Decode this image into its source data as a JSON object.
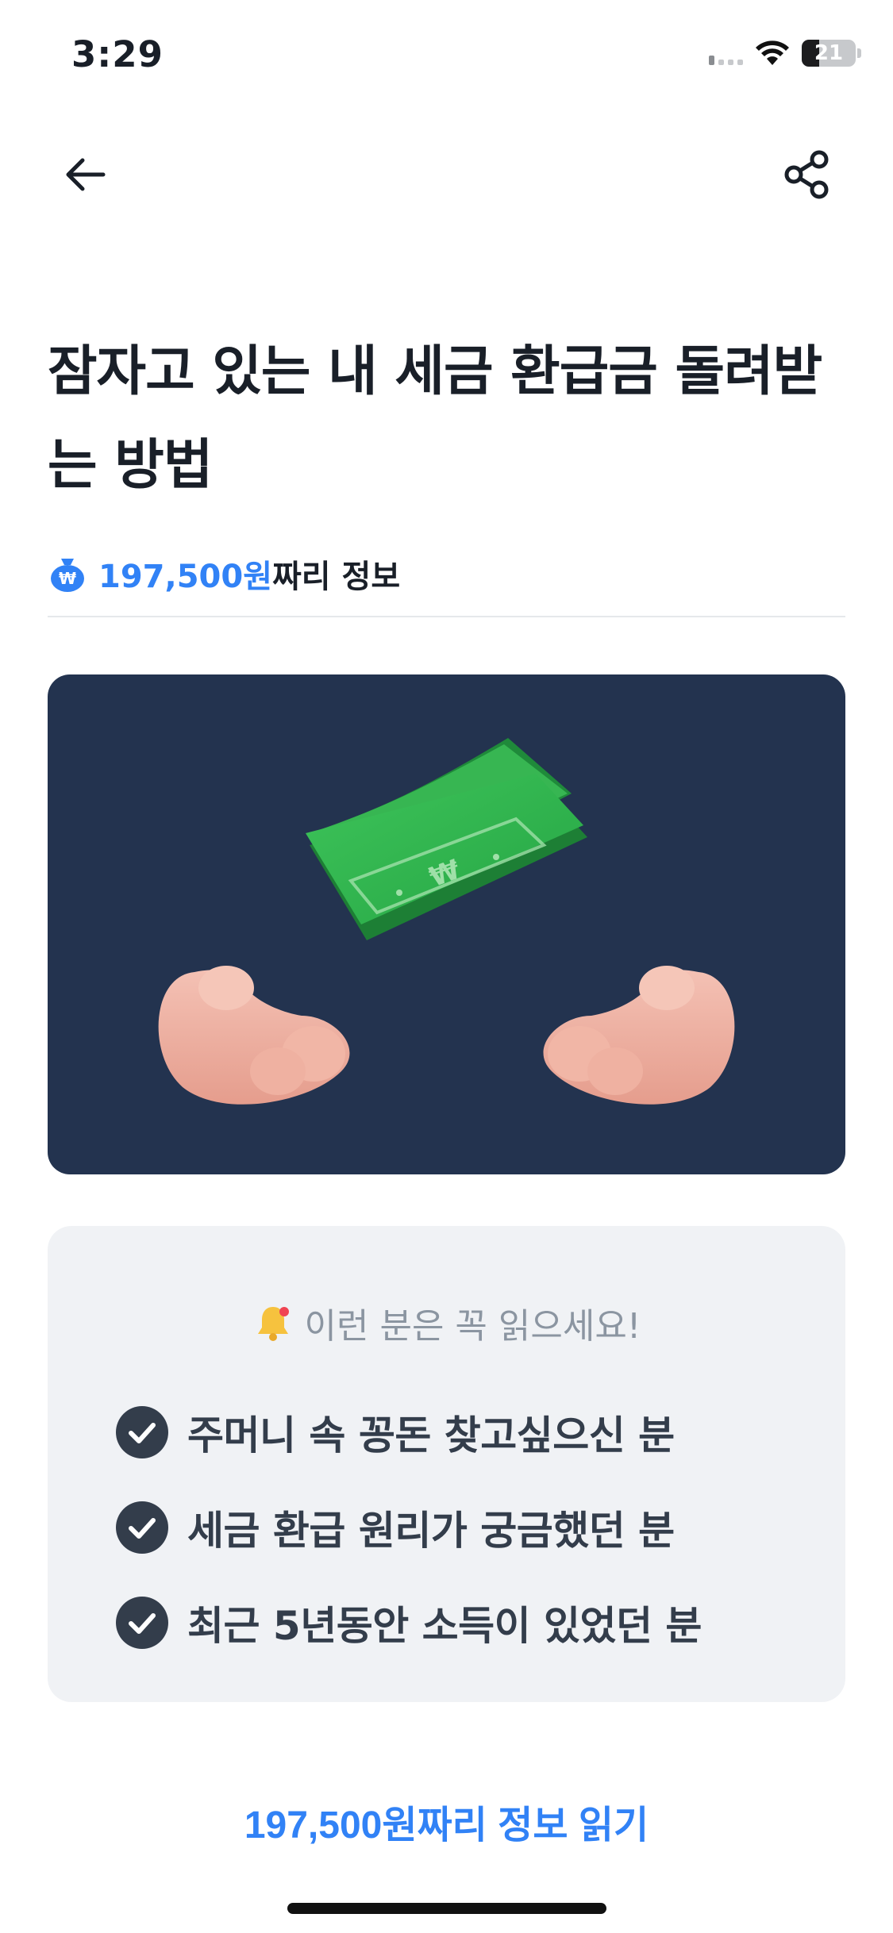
{
  "status_bar": {
    "time": "3:29",
    "battery": "21"
  },
  "nav": {
    "back_icon": "arrow-left-icon",
    "share_icon": "share-icon"
  },
  "article": {
    "title": "잠자고 있는 내 세금 환급금 돌려받는 방법",
    "value_amount": "197,500원",
    "value_suffix": "짜리 정보",
    "hero_icon": "money-hands-illustration"
  },
  "info_card": {
    "header": "이런 분은 꼭 읽으세요!",
    "items": [
      {
        "label": "주머니 속 꽁돈 찾고싶으신 분"
      },
      {
        "label": "세금 환급 원리가 궁금했던 분"
      },
      {
        "label": "최근 5년동안 소득이 있었던 분"
      }
    ]
  },
  "cta": {
    "label": "197,500원짜리 정보 읽기"
  },
  "colors": {
    "accent": "#3182f6",
    "hero_bg": "#23334f",
    "card_bg": "#f0f2f5",
    "bill_green": "#2fae4b"
  }
}
